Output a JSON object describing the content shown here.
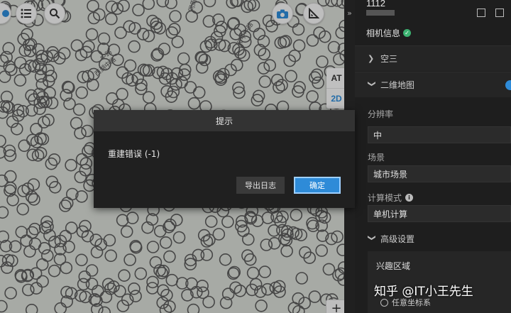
{
  "map": {
    "road_labels": [
      "同周中路",
      "中路",
      "西湖中路",
      "和平中路"
    ]
  },
  "view_toggle": {
    "at_label": "AT",
    "two_d_label": "2D"
  },
  "zoom": {
    "in_label": "+"
  },
  "expand": {
    "label": "»"
  },
  "panel": {
    "header_value": "1112",
    "camera_info_label": "相机信息",
    "camera_status_color": "#3cb371",
    "section_empty_label": "空三",
    "section_2d_label": "二维地图",
    "resolution_label": "分辨率",
    "resolution_value": "中",
    "scene_label": "场景",
    "scene_value": "城市场景",
    "compute_mode_label": "计算模式",
    "compute_mode_value": "单机计算",
    "advanced_label": "高级设置",
    "roi_label": "兴趣区域",
    "coord_label": "任意坐标系"
  },
  "dialog": {
    "title": "提示",
    "message": "重建错误 (-1)",
    "export_log_label": "导出日志",
    "confirm_label": "确定",
    "confirm_color": "#2e8bd8"
  },
  "watermark": {
    "text": "知乎 @IT小王先生"
  },
  "colors": {
    "accent": "#2e8bd8",
    "map_bg": "#d7dad4"
  }
}
